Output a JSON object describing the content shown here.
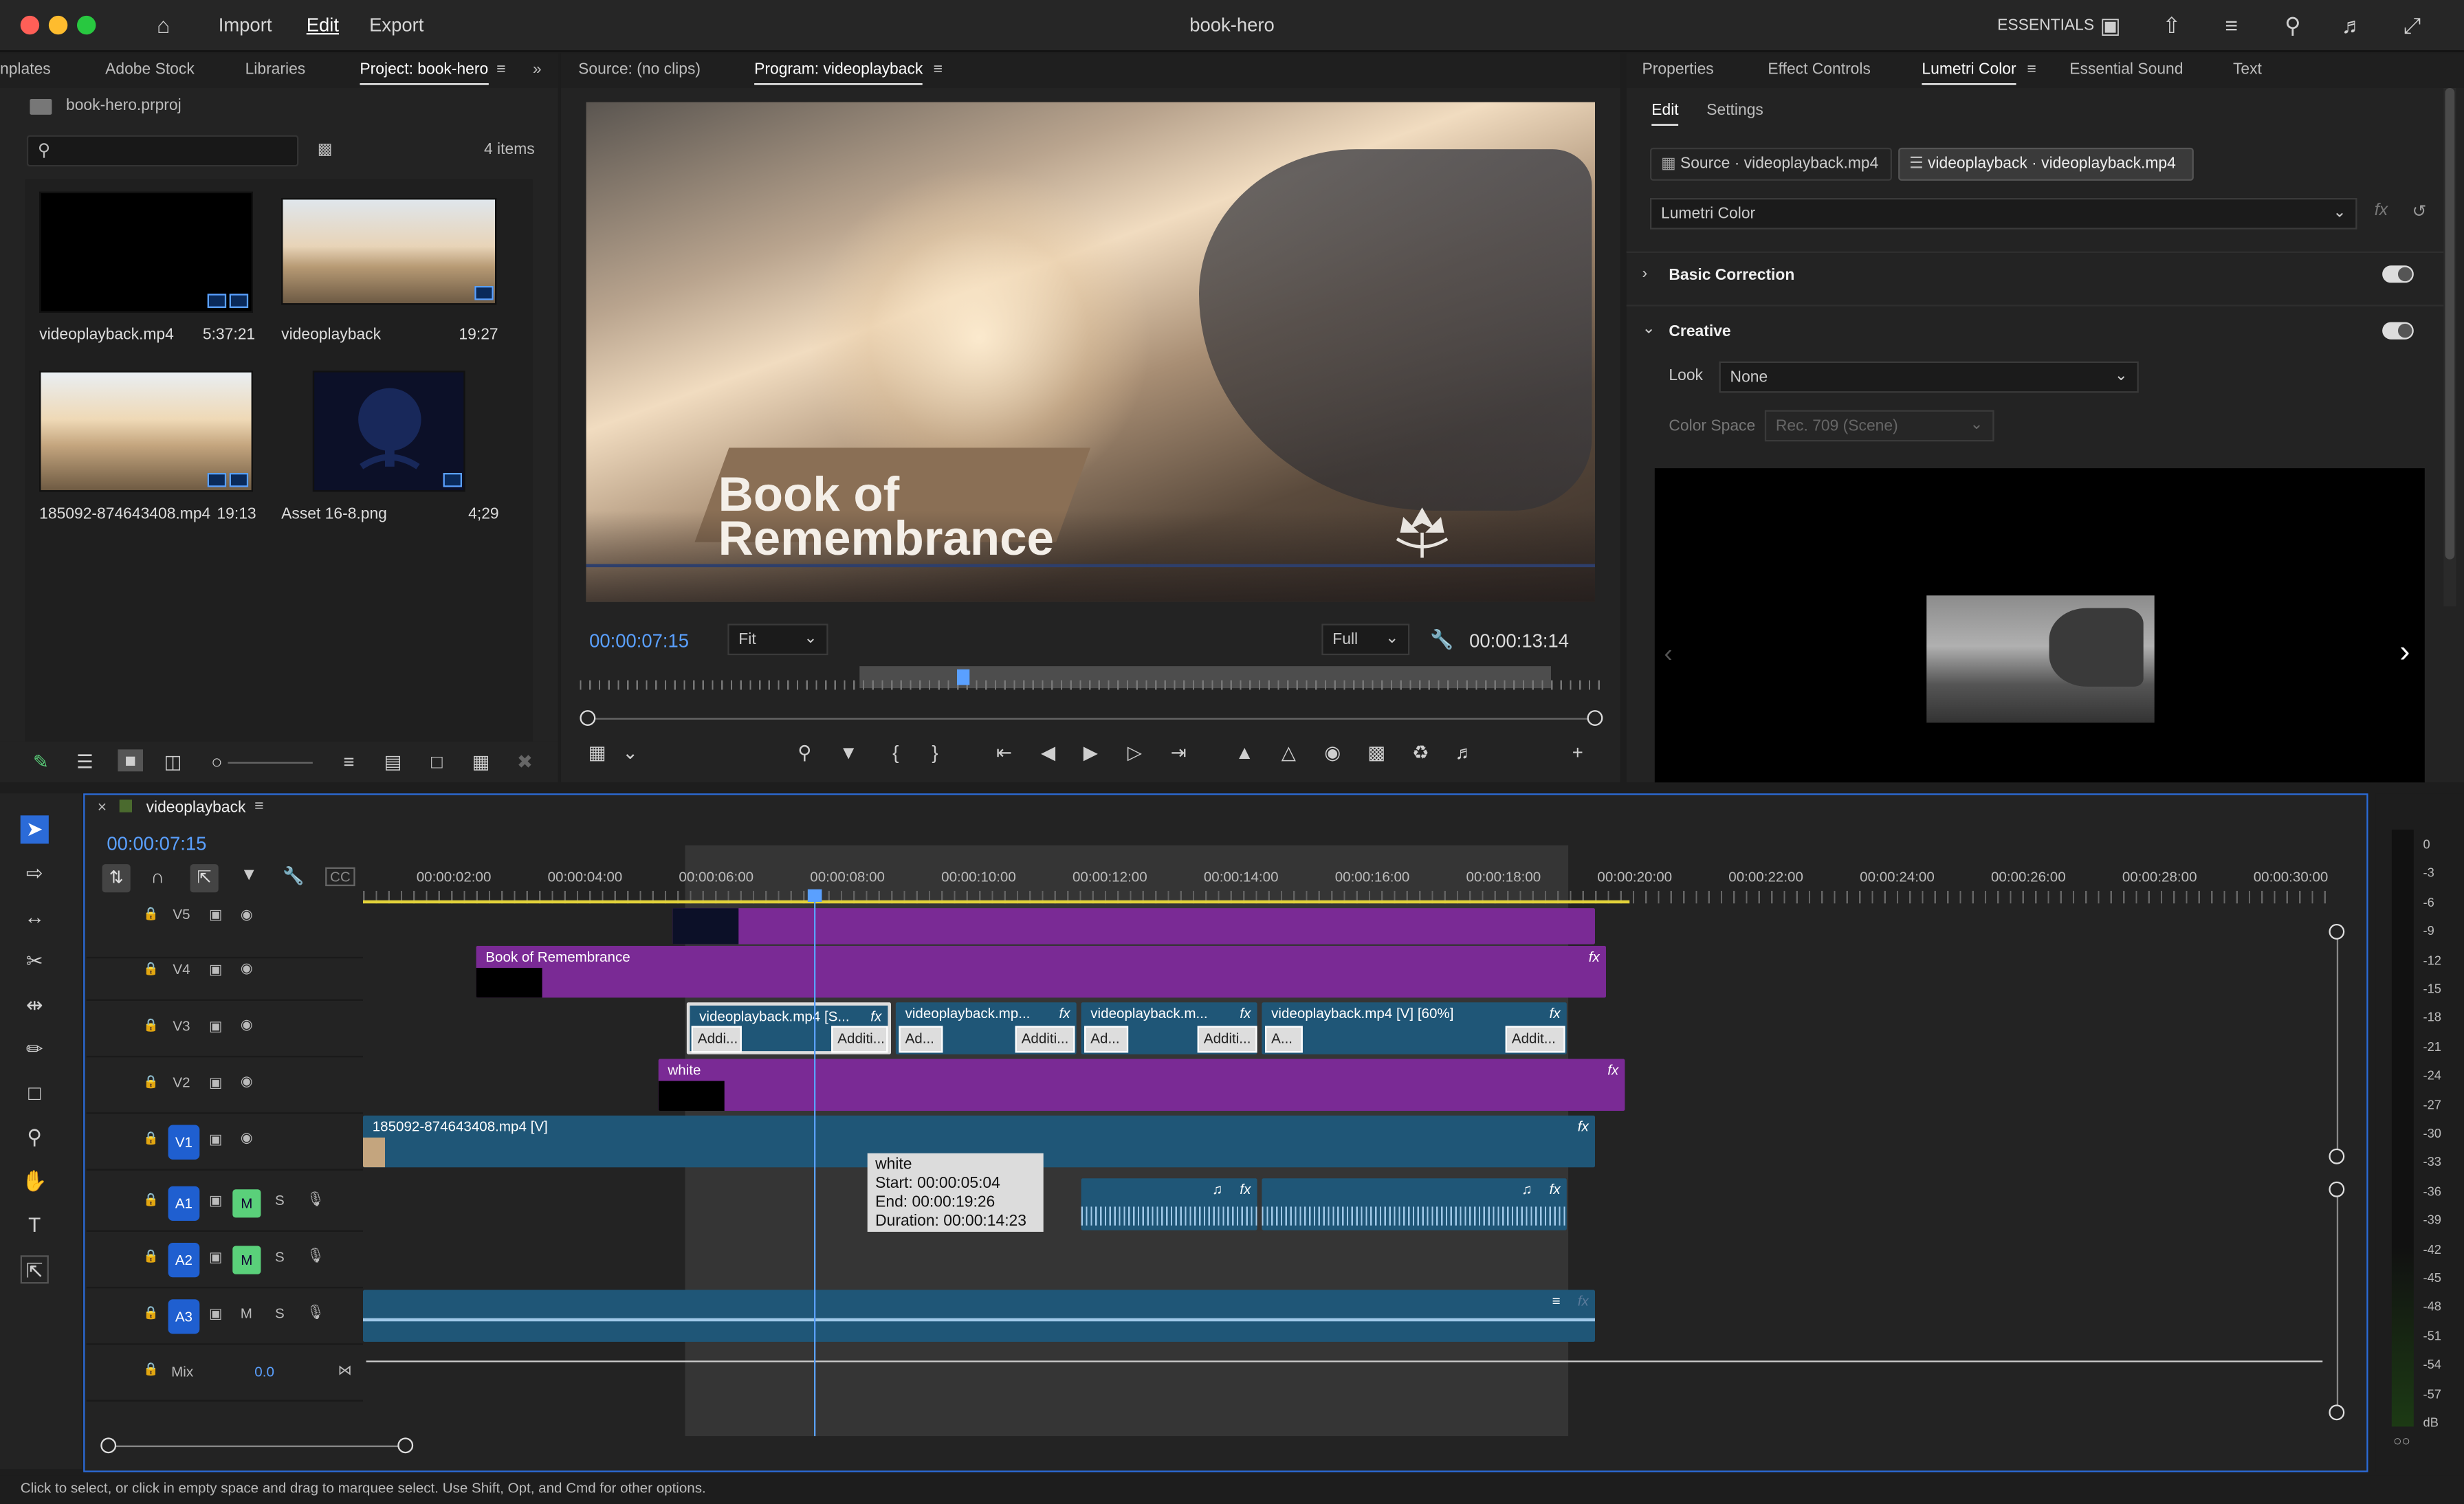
{
  "window": {
    "title": "book-hero",
    "workspace": "ESSENTIALS"
  },
  "menu": {
    "import": "Import",
    "edit": "Edit",
    "export": "Export"
  },
  "project_panel": {
    "tabs": [
      "nplates",
      "Adobe Stock",
      "Libraries",
      "Project: book-hero"
    ],
    "active_tab": "Project: book-hero",
    "file": "book-hero.prproj",
    "search_placeholder": "",
    "item_count": "4 items",
    "items": [
      {
        "name": "videoplayback.mp4",
        "duration": "5:37:21"
      },
      {
        "name": "videoplayback",
        "duration": "19:27"
      },
      {
        "name": "185092-874643408.mp4",
        "duration": "19:13"
      },
      {
        "name": "Asset 16-8.png",
        "duration": "4;29"
      }
    ]
  },
  "monitor": {
    "source_tab": "Source: (no clips)",
    "program_tab": "Program: videoplayback",
    "overlay_line1": "Book of",
    "overlay_line2": "Remembrance",
    "timecode_current": "00:00:07:15",
    "fit": "Fit",
    "quality": "Full",
    "timecode_duration": "00:00:13:14"
  },
  "right_panel": {
    "tabs": [
      "Properties",
      "Effect Controls",
      "Lumetri Color",
      "Essential Sound",
      "Text"
    ],
    "active_tab": "Lumetri Color",
    "subtabs": [
      "Edit",
      "Settings"
    ],
    "source_chip": "Source · videoplayback.mp4",
    "target_chip": "videoplayback · videoplayback.mp4",
    "effect_select": "Lumetri Color",
    "fx_label": "fx",
    "basic_correction": "Basic Correction",
    "creative": "Creative",
    "look_label": "Look",
    "look_value": "None",
    "color_space_label": "Color Space",
    "color_space_value": "Rec. 709 (Scene)"
  },
  "timeline": {
    "sequence_name": "videoplayback",
    "timecode": "00:00:07:15",
    "ruler": [
      "00:00:02:00",
      "00:00:04:00",
      "00:00:06:00",
      "00:00:08:00",
      "00:00:10:00",
      "00:00:12:00",
      "00:00:14:00",
      "00:00:16:00",
      "00:00:18:00",
      "00:00:20:00",
      "00:00:22:00",
      "00:00:24:00",
      "00:00:26:00",
      "00:00:28:00",
      "00:00:30:00"
    ],
    "tracks": [
      "V5",
      "V4",
      "V3",
      "V2",
      "V1",
      "A1",
      "A2",
      "A3"
    ],
    "mix_label": "Mix",
    "mix_value": "0.0",
    "m_label": "M",
    "s_label": "S",
    "clips": {
      "v4": "Book of Remembrance",
      "v3a": "videoplayback.mp4 [S...",
      "v3b": "videoplayback.mp...",
      "v3c": "videoplayback.m...",
      "v3d": "videoplayback.mp4 [V] [60%]",
      "v2": "white",
      "v1": "185092-874643408.mp4 [V]"
    },
    "subclips": [
      "Addi...",
      "Additi...",
      "Ad...",
      "Additi...",
      "Ad...",
      "Additi...",
      "A...",
      "Addit..."
    ],
    "tooltip": {
      "name": "white",
      "start": "Start: 00:00:05:04",
      "end": "End: 00:00:19:26",
      "duration": "Duration: 00:00:14:23"
    },
    "fx": "fx"
  },
  "meter": {
    "labels": [
      "0",
      "-3",
      "-6",
      "-9",
      "-12",
      "-15",
      "-18",
      "-21",
      "-24",
      "-27",
      "-30",
      "-33",
      "-36",
      "-39",
      "-42",
      "-45",
      "-48",
      "-51",
      "-54",
      "-57",
      "dB"
    ]
  },
  "status": "Click to select, or click in empty space and drag to marquee select. Use Shift, Opt, and Cmd for other options."
}
